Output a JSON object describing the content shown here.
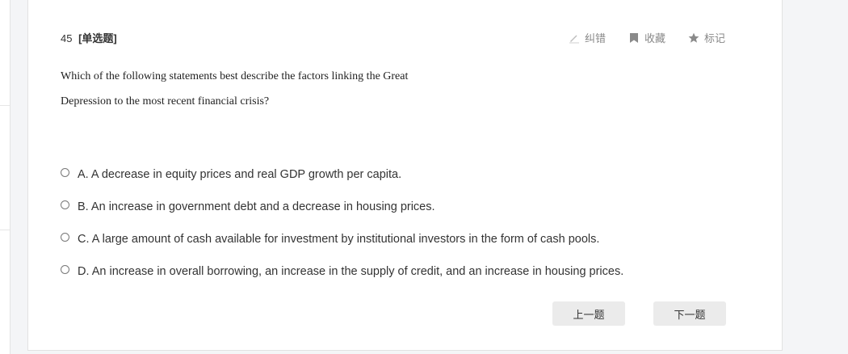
{
  "question": {
    "number": "45",
    "type": "[单选题]",
    "stem_line1": "Which of the following statements best describe the factors linking the Great",
    "stem_line2": "Depression to the most recent financial crisis?"
  },
  "tools": {
    "report_label": "纠错",
    "favorite_label": "收藏",
    "mark_label": "标记"
  },
  "options": [
    {
      "text": "A. A decrease in equity prices and real GDP growth per capita."
    },
    {
      "text": "B. An increase in government debt and a decrease in housing prices."
    },
    {
      "text": "C. A large amount of cash available for investment by institutional investors in the form of cash pools."
    },
    {
      "text": "D. An increase in overall borrowing, an increase in the supply of credit, and an increase in housing prices."
    }
  ],
  "navigation": {
    "prev_label": "上一题",
    "next_label": "下一题"
  },
  "icons": {
    "report": "pencil-icon",
    "favorite": "bookmark-icon",
    "mark": "star-icon"
  },
  "colors": {
    "tool_text": "#888888",
    "button_bg": "#ebebeb",
    "card_bg": "#ffffff",
    "page_bg": "#f4f5f7"
  }
}
